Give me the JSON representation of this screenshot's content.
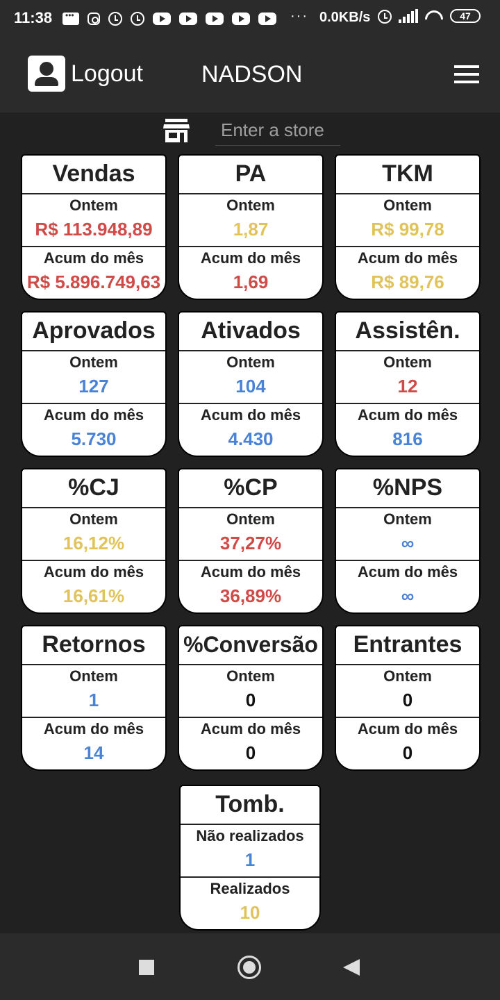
{
  "status_bar": {
    "time": "11:38",
    "dots": "···",
    "net_speed": "0.0KB/s",
    "battery": "47"
  },
  "app_bar": {
    "logout_label": "Logout",
    "user_name": "NADSON"
  },
  "store_search": {
    "placeholder": "Enter a store"
  },
  "cards": [
    {
      "title": "Vendas",
      "label1": "Ontem",
      "value1": "R$ 113.948,89",
      "color1": "#d04a47",
      "label2": "Acum do mês",
      "value2": "R$ 5.896.749,63",
      "color2": "#d04a47"
    },
    {
      "title": "PA",
      "label1": "Ontem",
      "value1": "1,87",
      "color1": "#e0c35a",
      "label2": "Acum do mês",
      "value2": "1,69",
      "color2": "#d04a47"
    },
    {
      "title": "TKM",
      "label1": "Ontem",
      "value1": "R$ 99,78",
      "color1": "#e0c35a",
      "label2": "Acum do mês",
      "value2": "R$ 89,76",
      "color2": "#e0c35a"
    },
    {
      "title": "Aprovados",
      "label1": "Ontem",
      "value1": "127",
      "color1": "#4a83d6",
      "label2": "Acum do mês",
      "value2": "5.730",
      "color2": "#4a83d6"
    },
    {
      "title": "Ativados",
      "label1": "Ontem",
      "value1": "104",
      "color1": "#4a83d6",
      "label2": "Acum do mês",
      "value2": "4.430",
      "color2": "#4a83d6"
    },
    {
      "title": "Assistên.",
      "label1": "Ontem",
      "value1": "12",
      "color1": "#d04a47",
      "label2": "Acum do mês",
      "value2": "816",
      "color2": "#4a83d6"
    },
    {
      "title": "%CJ",
      "label1": "Ontem",
      "value1": "16,12%",
      "color1": "#e0c35a",
      "label2": "Acum do mês",
      "value2": "16,61%",
      "color2": "#e0c35a"
    },
    {
      "title": "%CP",
      "label1": "Ontem",
      "value1": "37,27%",
      "color1": "#d04a47",
      "label2": "Acum do mês",
      "value2": "36,89%",
      "color2": "#d04a47"
    },
    {
      "title": "%NPS",
      "label1": "Ontem",
      "value1": "∞",
      "color1": "#4a83d6",
      "label2": "Acum do mês",
      "value2": "∞",
      "color2": "#4a83d6"
    },
    {
      "title": "Retornos",
      "label1": "Ontem",
      "value1": "1",
      "color1": "#4a83d6",
      "label2": "Acum do mês",
      "value2": "14",
      "color2": "#4a83d6"
    },
    {
      "title": "%Conversão",
      "label1": "Ontem",
      "value1": "0",
      "color1": "#111111",
      "label2": "Acum do mês",
      "value2": "0",
      "color2": "#111111"
    },
    {
      "title": "Entrantes",
      "label1": "Ontem",
      "value1": "0",
      "color1": "#111111",
      "label2": "Acum do mês",
      "value2": "0",
      "color2": "#111111"
    },
    {
      "title": "Tomb.",
      "label1": "Não realizados",
      "value1": "1",
      "color1": "#4a83d6",
      "label2": "Realizados",
      "value2": "10",
      "color2": "#e0c35a"
    }
  ]
}
